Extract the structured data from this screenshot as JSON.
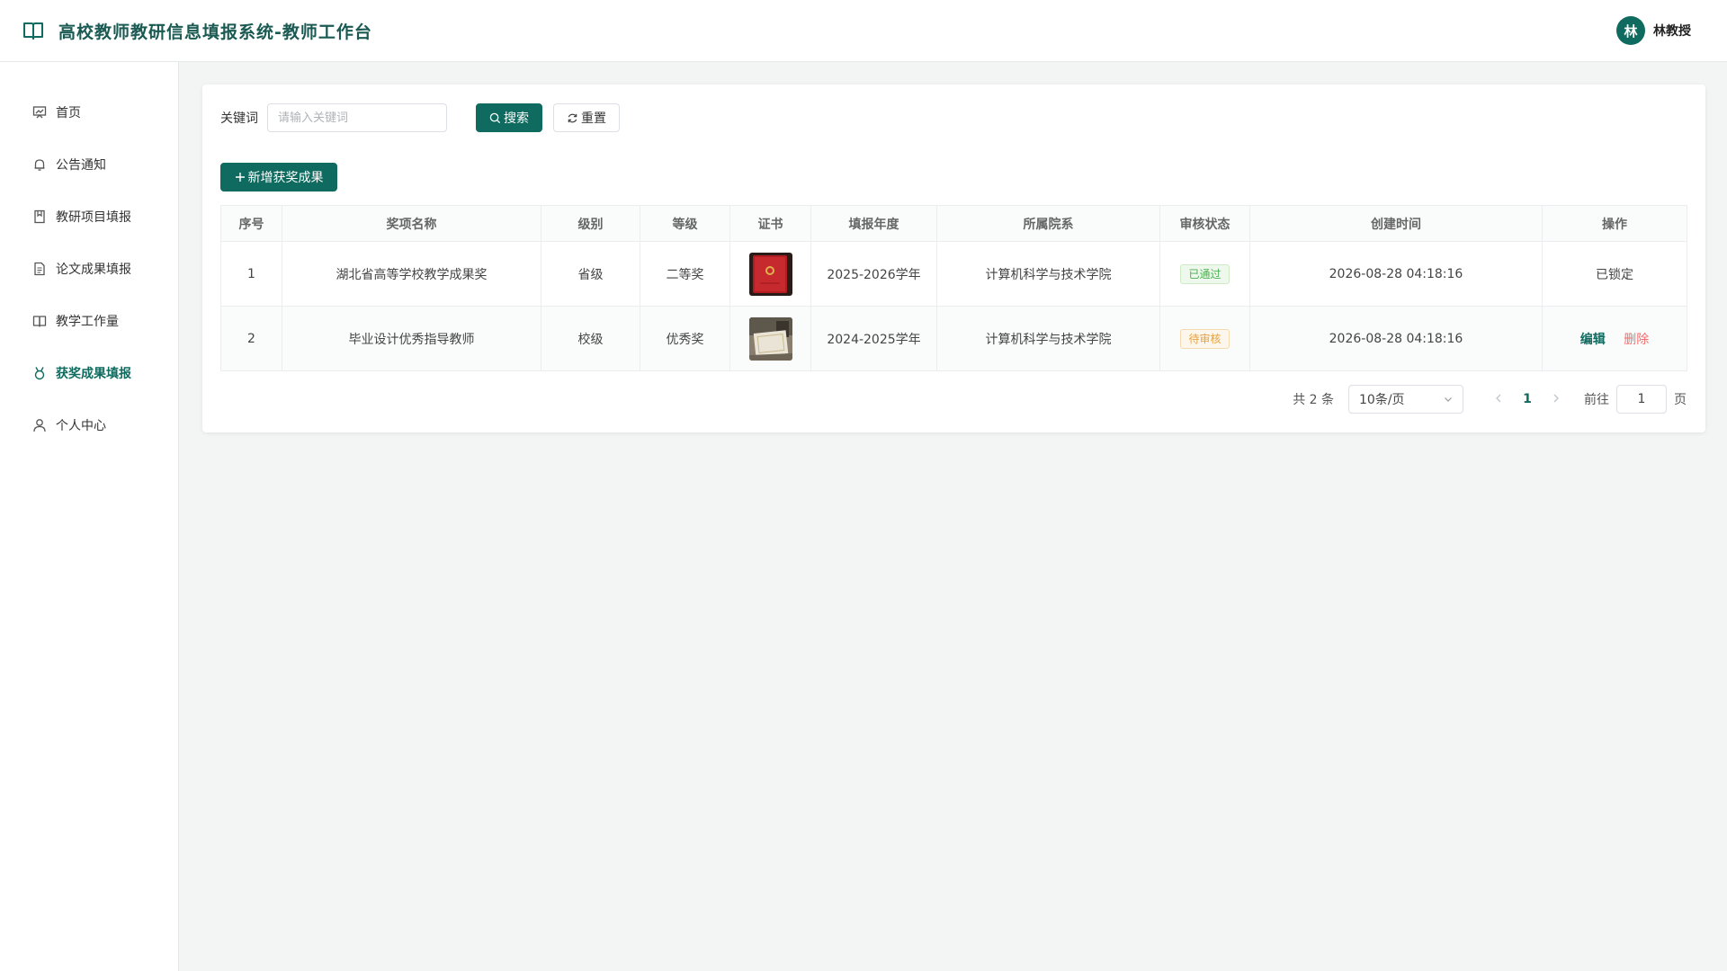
{
  "header": {
    "title": "高校教师教研信息填报系统-教师工作台",
    "avatar_initial": "林",
    "user_name": "林教授"
  },
  "sidebar": {
    "items": [
      {
        "label": "首页",
        "icon": "dashboard-icon",
        "active": false
      },
      {
        "label": "公告通知",
        "icon": "bell-icon",
        "active": false
      },
      {
        "label": "教研项目填报",
        "icon": "notebook-icon",
        "active": false
      },
      {
        "label": "论文成果填报",
        "icon": "document-icon",
        "active": false
      },
      {
        "label": "教学工作量",
        "icon": "book-icon",
        "active": false
      },
      {
        "label": "获奖成果填报",
        "icon": "medal-icon",
        "active": true
      },
      {
        "label": "个人中心",
        "icon": "user-icon",
        "active": false
      }
    ]
  },
  "search": {
    "label": "关键词",
    "placeholder": "请输入关键词",
    "value": "",
    "search_button": "搜索",
    "reset_button": "重置"
  },
  "toolbar": {
    "add_button": "新增获奖成果"
  },
  "table": {
    "columns": [
      "序号",
      "奖项名称",
      "级别",
      "等级",
      "证书",
      "填报年度",
      "所属院系",
      "审核状态",
      "创建时间",
      "操作"
    ],
    "rows": [
      {
        "index": "1",
        "name": "湖北省高等学校教学成果奖",
        "level": "省级",
        "grade": "二等奖",
        "certificate": "red-certificate-thumbnail",
        "year": "2025-2026学年",
        "department": "计算机科学与技术学院",
        "status": "已通过",
        "created": "2026-08-28 04:18:16",
        "action_text": "已锁定"
      },
      {
        "index": "2",
        "name": "毕业设计优秀指导教师",
        "level": "校级",
        "grade": "优秀奖",
        "certificate": "desk-certificate-thumbnail",
        "year": "2024-2025学年",
        "department": "计算机科学与技术学院",
        "status": "待审核",
        "created": "2026-08-28 04:18:16",
        "edit_label": "编辑",
        "delete_label": "删除"
      }
    ]
  },
  "pagination": {
    "total": "共 2 条",
    "page_size": "10条/页",
    "current_page": "1",
    "goto_label": "前往",
    "goto_value": "1",
    "goto_suffix": "页"
  },
  "colors": {
    "primary": "#0f6b5f",
    "success": "#4caf50",
    "warning": "#e6a23c",
    "danger": "#f56c6c"
  }
}
